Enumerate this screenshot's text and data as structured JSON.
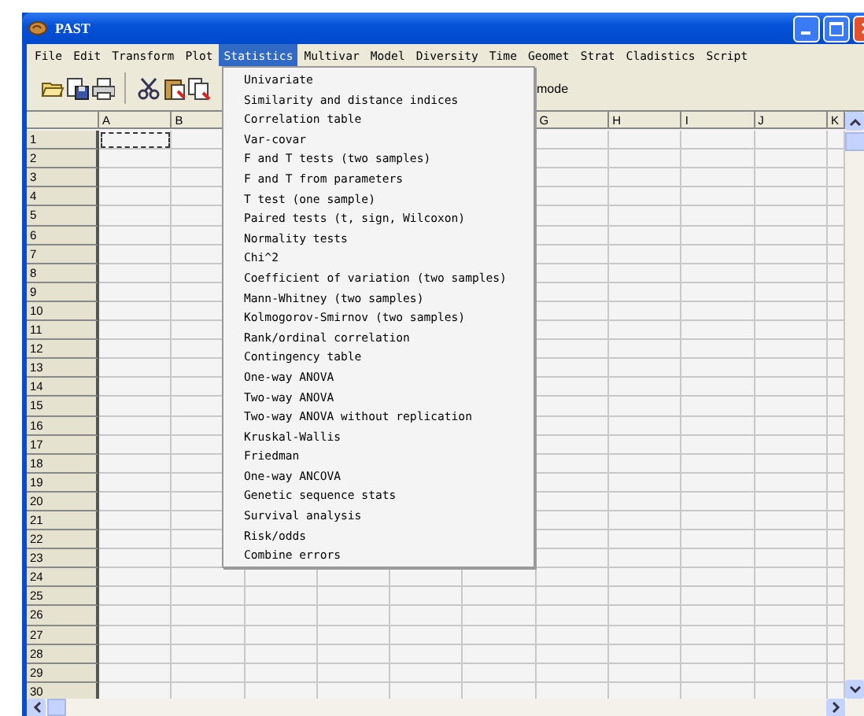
{
  "window": {
    "title": "PAST"
  },
  "menu_bar": [
    {
      "label": "File",
      "selected": false
    },
    {
      "label": "Edit",
      "selected": false
    },
    {
      "label": "Transform",
      "selected": false
    },
    {
      "label": "Plot",
      "selected": false
    },
    {
      "label": "Statistics",
      "selected": true
    },
    {
      "label": "Multivar",
      "selected": false
    },
    {
      "label": "Model",
      "selected": false
    },
    {
      "label": "Diversity",
      "selected": false
    },
    {
      "label": "Time",
      "selected": false
    },
    {
      "label": "Geomet",
      "selected": false
    },
    {
      "label": "Strat",
      "selected": false
    },
    {
      "label": "Cladistics",
      "selected": false
    },
    {
      "label": "Script",
      "selected": false
    }
  ],
  "toolbar": {
    "buttons": [
      {
        "kind": "open"
      },
      {
        "kind": "save"
      },
      {
        "kind": "print"
      },
      {
        "kind": "separator"
      },
      {
        "kind": "cut"
      },
      {
        "kind": "paste"
      },
      {
        "kind": "copy"
      }
    ],
    "mode_label": "mode"
  },
  "statistics_menu": {
    "items": [
      "Univariate",
      "Similarity and distance indices",
      "Correlation table",
      "Var-covar",
      "F and T tests (two samples)",
      "F and T from parameters",
      "T test (one sample)",
      "Paired tests (t, sign, Wilcoxon)",
      "Normality tests",
      "Chi^2",
      "Coefficient of variation (two samples)",
      "Mann-Whitney (two samples)",
      "Kolmogorov-Smirnov (two samples)",
      "Rank/ordinal correlation",
      "Contingency table",
      "One-way ANOVA",
      "Two-way ANOVA",
      "Two-way ANOVA without replication",
      "Kruskal-Wallis",
      "Friedman",
      "One-way ANCOVA",
      "Genetic sequence stats",
      "Survival analysis",
      "Risk/odds",
      "Combine errors"
    ]
  },
  "grid": {
    "columns": [
      {
        "label": "A"
      },
      {
        "label": "B"
      },
      {},
      {},
      {},
      {},
      {
        "label": "G"
      },
      {
        "label": "H"
      },
      {
        "label": "I"
      },
      {
        "label": "J"
      },
      {
        "label": "K"
      }
    ],
    "rows": [
      {
        "label": "1",
        "focused": true
      },
      {
        "label": "2",
        "focused": false
      },
      {
        "label": "3",
        "focused": false
      },
      {
        "label": "4",
        "focused": false
      },
      {
        "label": "5",
        "focused": false
      },
      {
        "label": "6",
        "focused": false
      },
      {
        "label": "7",
        "focused": false
      },
      {
        "label": "8",
        "focused": false
      },
      {
        "label": "9",
        "focused": false
      },
      {
        "label": "10",
        "focused": false
      },
      {
        "label": "11",
        "focused": false
      },
      {
        "label": "12",
        "focused": false
      },
      {
        "label": "13",
        "focused": false
      },
      {
        "label": "14",
        "focused": false
      },
      {
        "label": "15",
        "focused": false
      },
      {
        "label": "16",
        "focused": false
      },
      {
        "label": "17",
        "focused": false
      },
      {
        "label": "18",
        "focused": false
      },
      {
        "label": "19",
        "focused": false
      },
      {
        "label": "20",
        "focused": false
      },
      {
        "label": "21",
        "focused": false
      },
      {
        "label": "22",
        "focused": false
      },
      {
        "label": "23",
        "focused": false
      },
      {
        "label": "24",
        "focused": false
      },
      {
        "label": "25",
        "focused": false
      },
      {
        "label": "26",
        "focused": false
      },
      {
        "label": "27",
        "focused": false
      },
      {
        "label": "28",
        "focused": false
      },
      {
        "label": "29",
        "focused": false
      },
      {
        "label": "30",
        "focused": false
      }
    ]
  }
}
